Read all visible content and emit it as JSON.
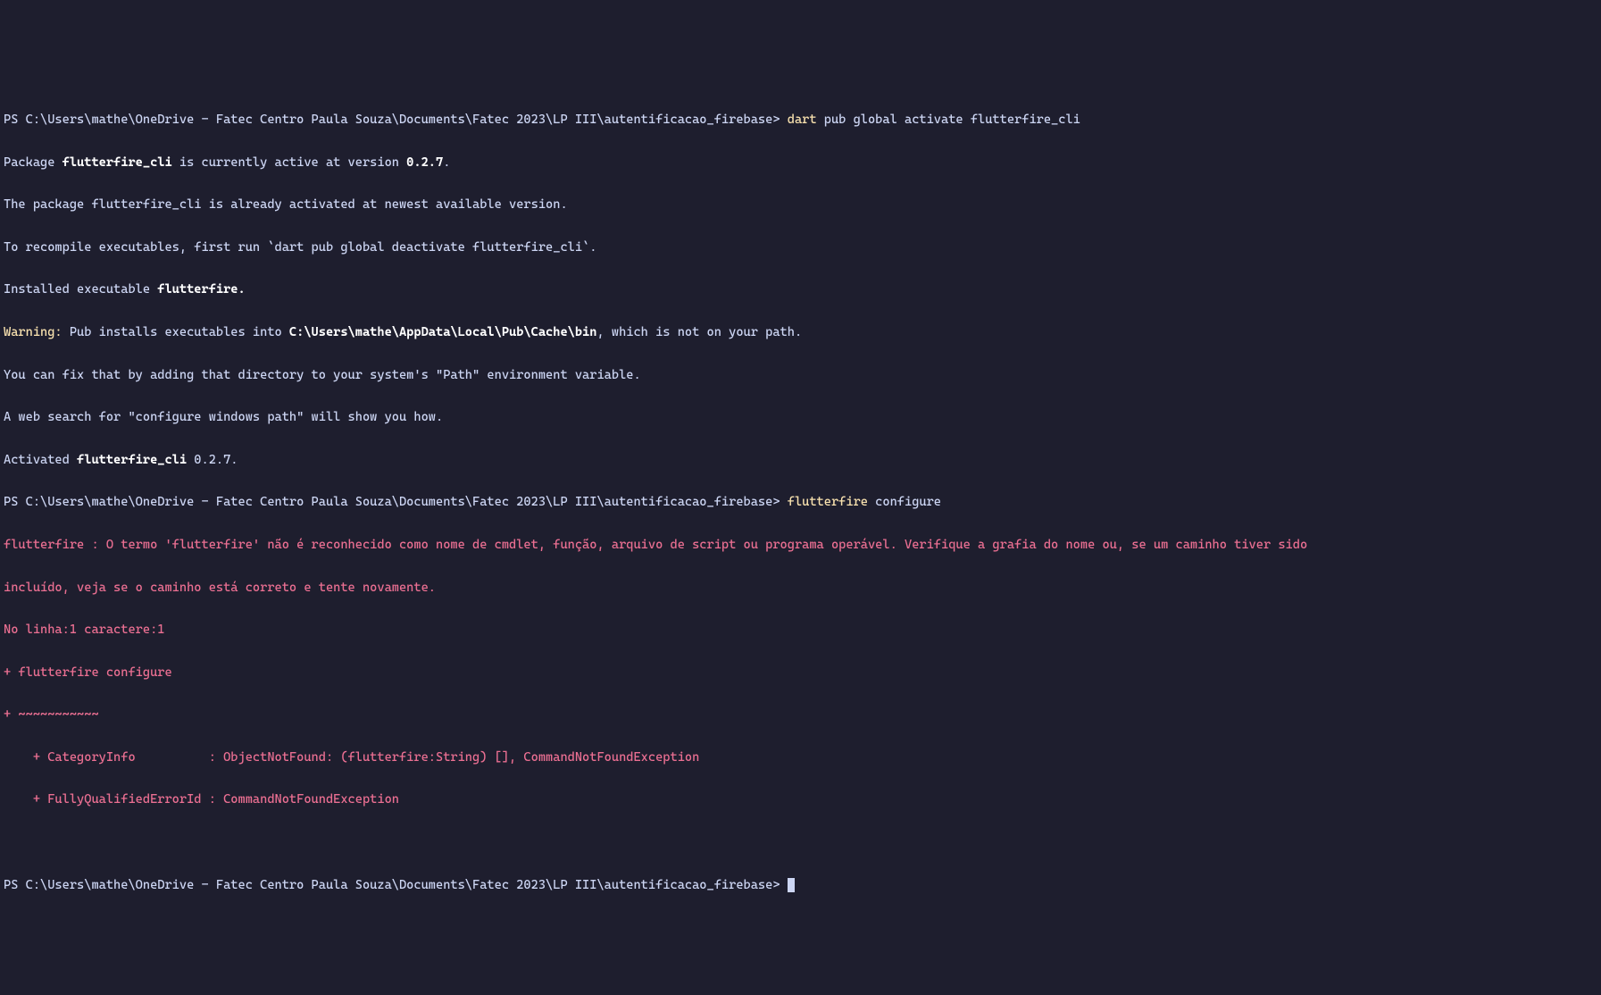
{
  "terminal": {
    "line1_prompt": "PS C:\\Users\\mathe\\OneDrive - Fatec Centro Paula Souza\\Documents\\Fatec 2023\\LP III\\autentificacao_firebase> ",
    "line1_cmd": "dart",
    "line1_rest": " pub global activate flutterfire_cli",
    "line2_a": "Package ",
    "line2_b": "flutterfire_cli",
    "line2_c": " is currently active at version ",
    "line2_d": "0.2.7",
    "line2_e": ".",
    "line3": "The package flutterfire_cli is already activated at newest available version.",
    "line4": "To recompile executables, first run `dart pub global deactivate flutterfire_cli`.",
    "line5_a": "Installed executable ",
    "line5_b": "flutterfire.",
    "line6_a": "Warning:",
    "line6_b": " Pub installs executables into ",
    "line6_c": "C:\\Users\\mathe\\AppData\\Local\\Pub\\Cache\\bin",
    "line6_d": ", which is not on your path.",
    "line7": "You can fix that by adding that directory to your system's \"Path\" environment variable.",
    "line8": "A web search for \"configure windows path\" will show you how.",
    "line9_a": "Activated ",
    "line9_b": "flutterfire_cli",
    "line9_c": " 0.2.7.",
    "line10_prompt": "PS C:\\Users\\mathe\\OneDrive - Fatec Centro Paula Souza\\Documents\\Fatec 2023\\LP III\\autentificacao_firebase> ",
    "line10_cmd": "flutterfire",
    "line10_rest": " configure",
    "err1": "flutterfire : O termo 'flutterfire' não é reconhecido como nome de cmdlet, função, arquivo de script ou programa operável. Verifique a grafia do nome ou, se um caminho tiver sido ",
    "err2": "incluído, veja se o caminho está correto e tente novamente.",
    "err3": "No linha:1 caractere:1",
    "err4": "+ flutterfire configure",
    "err5": "+ ~~~~~~~~~~~",
    "err6": "    + CategoryInfo          : ObjectNotFound: (flutterfire:String) [], CommandNotFoundException",
    "err7": "    + FullyQualifiedErrorId : CommandNotFoundException",
    "blank": " ",
    "line_last_prompt": "PS C:\\Users\\mathe\\OneDrive - Fatec Centro Paula Souza\\Documents\\Fatec 2023\\LP III\\autentificacao_firebase> "
  }
}
